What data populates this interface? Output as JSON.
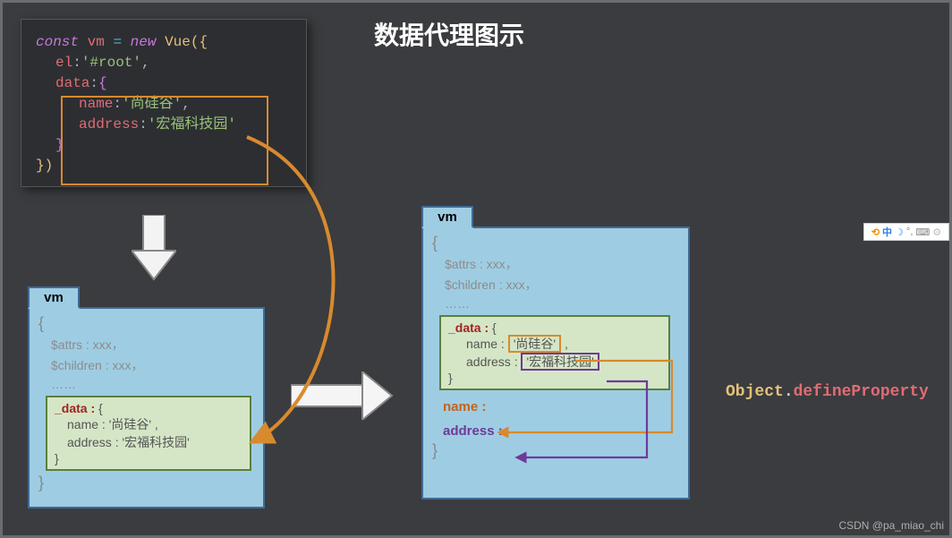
{
  "title": "数据代理图示",
  "code": {
    "const": "const",
    "vm": "vm",
    "eq": "=",
    "new": "new",
    "Vue": "Vue",
    "open": "({",
    "el_key": "el",
    "el_val": "'#root'",
    "data_key": "data",
    "open2": "{",
    "name_key": "name",
    "name_val": "'尚硅谷'",
    "addr_key": "address",
    "addr_val": "'宏福科技园'",
    "close2": "}",
    "close": "})"
  },
  "vm_left": {
    "tab": "vm",
    "open": "{",
    "attrs": "$attrs : xxx，",
    "children": "$children : xxx，",
    "dots": "……",
    "data_label": "_data :",
    "data_open": "{",
    "name_line": "name : '尚硅谷' ,",
    "addr_line": "address : '宏福科技园'",
    "data_close": "}",
    "close": "}"
  },
  "vm_right": {
    "tab": "vm",
    "open": "{",
    "attrs": "$attrs : xxx，",
    "children": "$children : xxx，",
    "dots": "……",
    "data_label": "_data :",
    "data_open": "{",
    "name_key": "name :",
    "name_val": "'尚硅谷'",
    "name_comma": ",",
    "addr_key": "address :",
    "addr_val": "'宏福科技园'",
    "data_close": "}",
    "name_prop": "name :",
    "addr_prop": "address :",
    "close": "}"
  },
  "defprop": {
    "obj": "Object",
    "dot": ".",
    "method": "defineProperty"
  },
  "ime": "中",
  "watermark": "CSDN @pa_miao_chi"
}
